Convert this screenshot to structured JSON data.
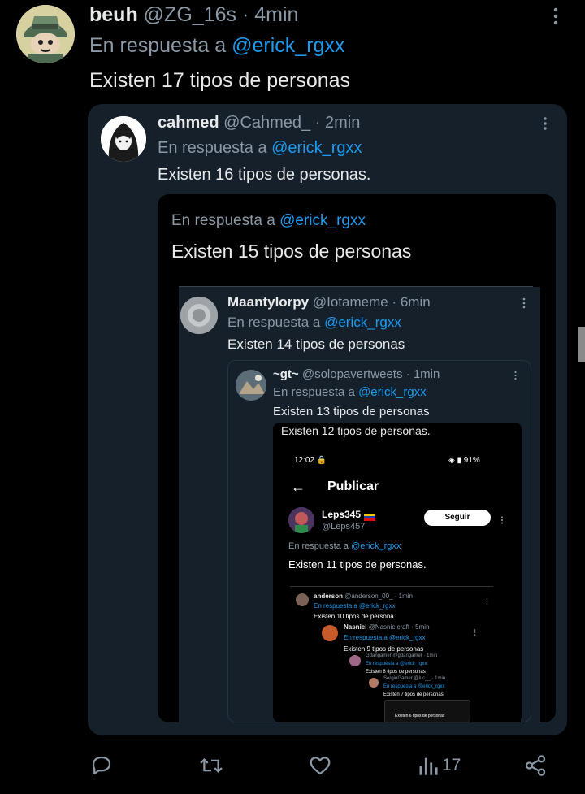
{
  "tweet": {
    "display_name": "beuh",
    "handle": "@ZG_16s",
    "time": "· 4min",
    "reply_prefix": "En respuesta a",
    "reply_to": "@erick_rgxx",
    "text": "Existen 17 tipos de personas",
    "views": "17"
  },
  "quote1": {
    "display_name": "cahmed",
    "handle": "@Cahmed_",
    "time": "· 2min",
    "reply_prefix": "En respuesta a",
    "reply_to": "@erick_rgxx",
    "text": "Existen 16 tipos de personas."
  },
  "quote2": {
    "reply_prefix": "En respuesta a",
    "reply_to": "@erick_rgxx",
    "text": "Existen 15 tipos de personas"
  },
  "quote3": {
    "display_name": "Maantylorpy",
    "handle": "@Iotameme",
    "time": "· 6min",
    "reply_prefix": "En respuesta a",
    "reply_to": "@erick_rgxx",
    "text": "Existen 14 tipos de personas"
  },
  "quote4": {
    "display_name": "~gt~",
    "handle": "@solopavertweets",
    "time": "· 1min",
    "reply_prefix": "En respuesta a",
    "reply_to": "@erick_rgxx",
    "text": "Existen 13 tipos de personas"
  },
  "quote5": {
    "text": "Existen 12 tipos de personas.",
    "phone_time": "12:02",
    "phone_status": "91%",
    "page_title": "Publicar",
    "display_name": "Leps345",
    "handle": "@Leps457",
    "follow_label": "Seguir",
    "reply_prefix": "En respuesta a",
    "reply_to": "@erick_rgxx",
    "post_text": "Existen 11 tipos de personas."
  },
  "quote6": {
    "display_name": "anderson",
    "handle": "@anderson_00_",
    "time": "· 1min",
    "reply_line": "En respuesta a @erick_rgxx",
    "text": "Existen 10 tipos de persona"
  },
  "quote7": {
    "display_name": "Nasniel",
    "handle": "@Nasnielcraft",
    "time": "· 5min",
    "reply_line": "En respuesta a @erick_rgxx",
    "text": "Existen 9 tipos de personas"
  },
  "quote8": {
    "header": "Gdangamer @gdangamer · 1min",
    "reply_line": "En respuesta a @erick_rgxx",
    "text": "Existen 8 tipos de personas"
  },
  "quote9": {
    "header": "SergioGamer @luc__ · 1min",
    "reply_line": "En respuesta a @erick_rgxx",
    "text": "Existen 7 tipos de personas"
  },
  "quote10": {
    "text": "Existen 6 tipos de personas"
  },
  "colors": {
    "background": "#000000",
    "card": "#15202b",
    "link": "#1d9bf0",
    "muted": "#8b98a5",
    "text": "#e7e9ea"
  }
}
